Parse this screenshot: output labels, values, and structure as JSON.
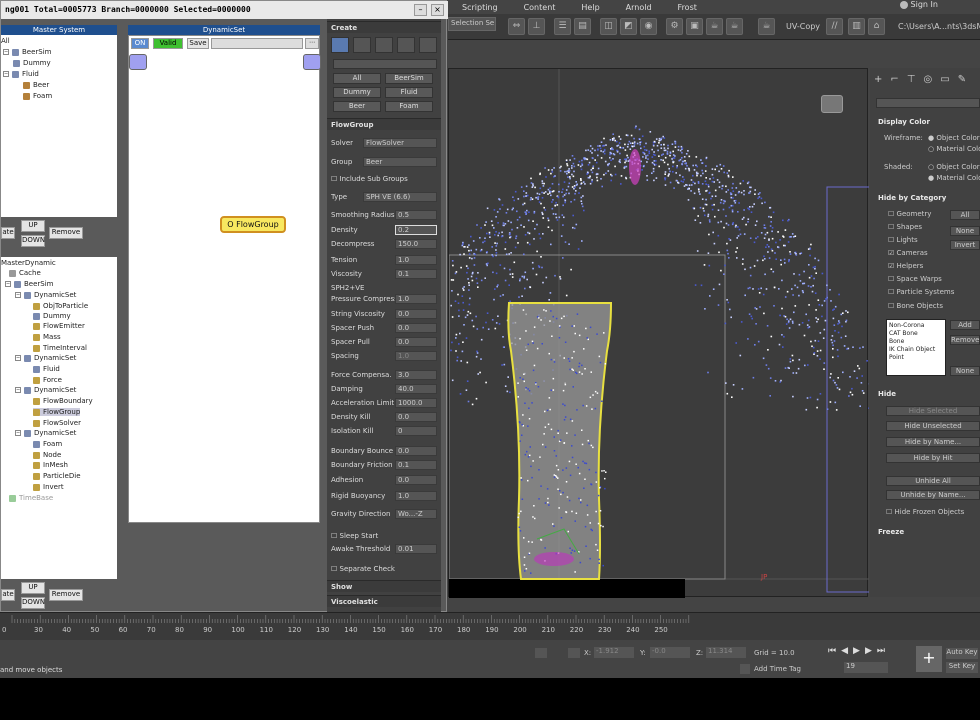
{
  "menubar": {
    "items": [
      "Scripting",
      "Content",
      "Help",
      "Arnold",
      "Frost"
    ],
    "signin": "Sign In"
  },
  "toolbar": {
    "selection_set": "Selection Se",
    "uv_copy": "UV-Copy",
    "path": "C:\\Users\\A...nts\\3dsMax"
  },
  "plugin": {
    "title": "ng001  Total=0005773  Branch=0000000  Selected=0000000",
    "master_system": {
      "header": "Master System",
      "tree": [
        "All",
        "BeerSim",
        "Dummy",
        "Fluid",
        "Beer",
        "Foam"
      ],
      "buttons": {
        "up": "UP",
        "down": "DOWN",
        "remove": "Remove",
        "left": "ate"
      }
    },
    "master_dynamic": {
      "header": "MasterDynamic",
      "tree": [
        "Cache",
        "BeerSim",
        "DynamicSet",
        "ObjToParticle",
        "Dummy",
        "FlowEmitter",
        "Mass",
        "TimeInterval",
        "DynamicSet",
        "Fluid",
        "Force",
        "DynamicSet",
        "FlowBoundary",
        "FlowGroup",
        "FlowSolver",
        "DynamicSet",
        "Foam",
        "Node",
        "InMesh",
        "ParticleDie",
        "Invert",
        "TimeBase"
      ],
      "buttons": {
        "up": "UP",
        "down": "DOWN",
        "remove": "Remove",
        "left": "ate"
      }
    },
    "dynamic_set": {
      "header": "DynamicSet",
      "on": "ON",
      "valid": "Valid",
      "save": "Save",
      "node": "O FlowGroup"
    }
  },
  "command_panel": {
    "create": "Create",
    "filter_buttons": [
      "All",
      "BeerSim",
      "Dummy",
      "Fluid",
      "Beer",
      "Foam"
    ],
    "flowgroup": "FlowGroup",
    "solver_label": "Solver",
    "solver": "FlowSolver",
    "group_label": "Group",
    "group": "Beer",
    "include_sub": "Include Sub Groups",
    "type_label": "Type",
    "type": "SPH VE (6.6)",
    "params": [
      {
        "label": "Smoothing Radius",
        "value": "0.5"
      },
      {
        "label": "Density",
        "value": "0.2"
      },
      {
        "label": "Decompress",
        "value": "150.0"
      },
      {
        "label": "Tension",
        "value": "1.0"
      },
      {
        "label": "Viscosity",
        "value": "0.1"
      }
    ],
    "sph2ve": "SPH2+VE",
    "params2": [
      {
        "label": "Pressure Compress",
        "value": "1.0"
      },
      {
        "label": "String Viscosity",
        "value": "0.0"
      },
      {
        "label": "Spacer Push",
        "value": "0.0"
      },
      {
        "label": "Spacer Pull",
        "value": "0.0"
      },
      {
        "label": "Spacing",
        "value": "1.0"
      }
    ],
    "params3": [
      {
        "label": "Force Compensa.",
        "value": "3.0"
      },
      {
        "label": "Damping",
        "value": "40.0"
      },
      {
        "label": "Acceleration Limit",
        "value": "1000.0"
      },
      {
        "label": "Density Kill",
        "value": "0.0"
      },
      {
        "label": "Isolation Kill",
        "value": "0"
      }
    ],
    "params4": [
      {
        "label": "Boundary Bounce",
        "value": "0.0"
      },
      {
        "label": "Boundary Friction",
        "value": "0.1"
      },
      {
        "label": "Adhesion",
        "value": "0.0"
      },
      {
        "label": "Rigid Buoyancy",
        "value": "1.0"
      }
    ],
    "gravity_label": "Gravity Direction",
    "gravity": "Wo...-Z",
    "sleep_start": "Sleep Start",
    "awake_label": "Awake Threshold",
    "awake": "0.01",
    "separate": "Separate Check",
    "show": "Show",
    "viscoelastic": "Viscoelastic"
  },
  "right_panel": {
    "display_color": "Display Color",
    "wireframe": "Wireframe:",
    "shaded": "Shaded:",
    "object_color": "Object Color",
    "material_color": "Material Color",
    "hide_by_category": "Hide by Category",
    "categories": [
      "Geometry",
      "Shapes",
      "Lights",
      "Cameras",
      "Helpers",
      "Space Warps",
      "Particle Systems",
      "Bone Objects"
    ],
    "cat_buttons": [
      "All",
      "None",
      "Invert"
    ],
    "list": [
      "Non-Corona",
      "CAT Bone",
      "Bone",
      "IK Chain Object",
      "Point"
    ],
    "add": "Add",
    "remove": "Remove",
    "none": "None",
    "hide": "Hide",
    "hide_buttons": [
      "Hide Selected",
      "Hide Unselected",
      "Hide by Name...",
      "Hide by Hit",
      "Unhide All",
      "Unhide by Name..."
    ],
    "hide_frozen": "Hide Frozen Objects",
    "freeze": "Freeze"
  },
  "timeline": {
    "ticks": [
      "30",
      "40",
      "50",
      "60",
      "70",
      "80",
      "90",
      "100",
      "110",
      "120",
      "130",
      "140",
      "150",
      "160",
      "170",
      "180",
      "190",
      "200",
      "210",
      "220",
      "230",
      "240",
      "250"
    ],
    "start_tick": "0"
  },
  "status": {
    "message": "and move objects",
    "x_label": "X:",
    "x": "-1.912",
    "y_label": "Y:",
    "y": "-0.0",
    "z_label": "Z:",
    "z": "11.314",
    "grid": "Grid = 10.0",
    "add_time_tag": "Add Time Tag",
    "frame": "19",
    "auto_key": "Auto Key",
    "set_key": "Set Key"
  },
  "viewport": {
    "axis_label": "JP"
  }
}
